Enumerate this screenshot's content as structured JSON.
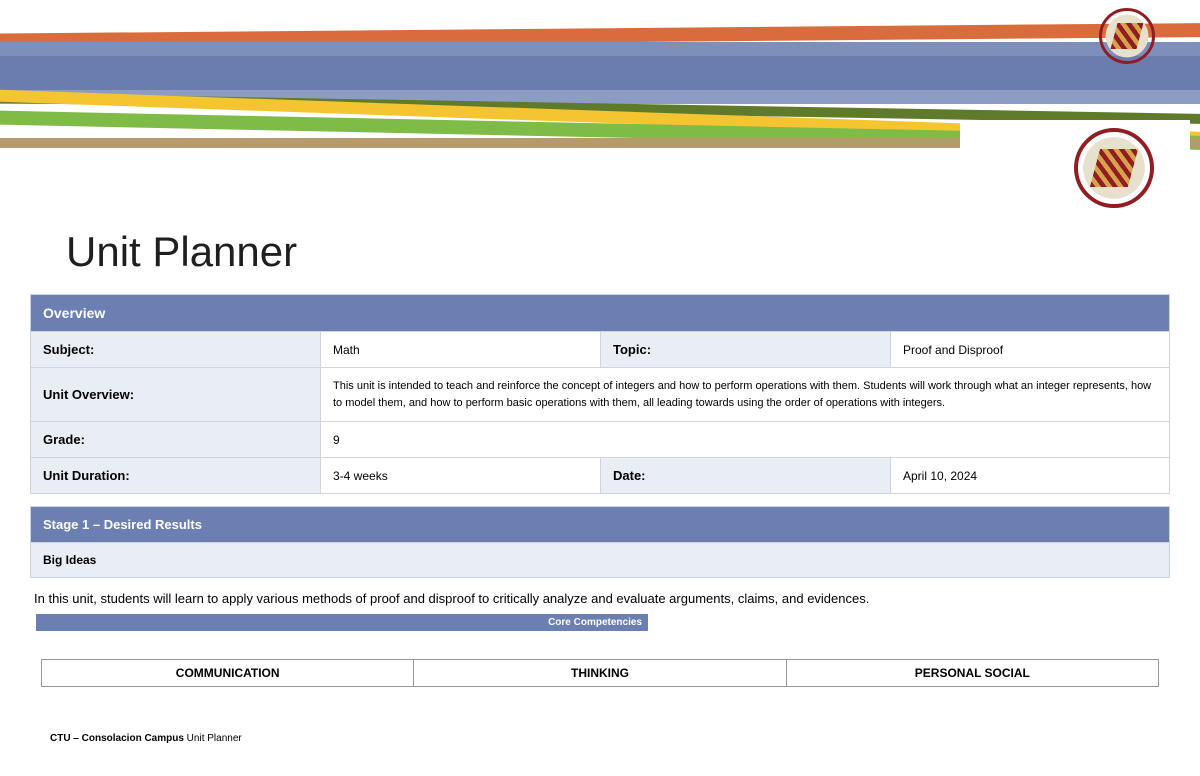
{
  "title": "Unit Planner",
  "overview": {
    "heading": "Overview",
    "rows": {
      "subject_label": "Subject:",
      "subject_value": "Math",
      "topic_label": "Topic:",
      "topic_value": "Proof and Disproof",
      "unitoverview_label": "Unit Overview:",
      "unitoverview_value": "This unit is intended to teach and reinforce the concept of integers and how to perform operations with them.  Students will work through what an integer represents, how to model them, and how to perform basic operations with them, all leading towards using the order of operations with integers.",
      "grade_label": "Grade:",
      "grade_value": "9",
      "duration_label": "Unit Duration:",
      "duration_value": "3-4 weeks",
      "date_label": "Date:",
      "date_value": " April 10, 2024"
    }
  },
  "stage1": {
    "heading": "Stage 1 – Desired Results",
    "big_ideas_label": "Big Ideas",
    "big_ideas_text": "In this unit, students will learn to apply various methods of proof and disproof to critically analyze and evaluate arguments, claims, and evidences.",
    "core_label": "Core Competencies",
    "competencies": {
      "col1": "COMMUNICATION",
      "col2": "THINKING",
      "col3": "PERSONAL SOCIAL"
    }
  },
  "footer": {
    "bold": "CTU – Consolacion Campus",
    "plain": " Unit Planner"
  }
}
